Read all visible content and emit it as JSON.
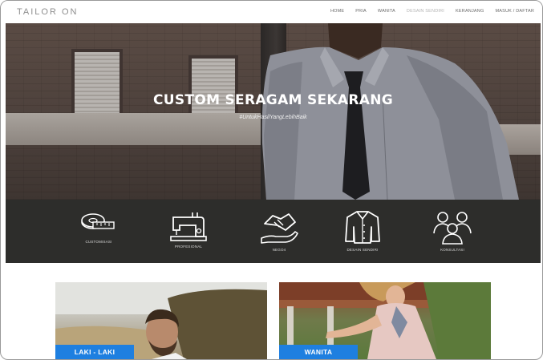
{
  "brand": "TAILOR ON",
  "nav": {
    "items": [
      {
        "label": "HOME",
        "muted": false
      },
      {
        "label": "PRIA",
        "muted": false
      },
      {
        "label": "WANITA",
        "muted": false
      },
      {
        "label": "DESAIN SENDIRI",
        "muted": true
      },
      {
        "label": "KERANJANG",
        "muted": false
      },
      {
        "label": "MASUK / DAFTAR",
        "muted": false
      }
    ]
  },
  "hero": {
    "title": "CUSTOM SERAGAM SEKARANG",
    "subtitle": "#UntukHasilYangLebihBaik"
  },
  "features": [
    {
      "label": "CUSTOMISASI",
      "icon": "measuring-tape-icon"
    },
    {
      "label": "PROFESIONAL",
      "icon": "sewing-machine-icon"
    },
    {
      "label": "NEGO4",
      "icon": "handshake-icon"
    },
    {
      "label": "DESAIN SENDIRI",
      "icon": "shirt-icon"
    },
    {
      "label": "KONSULTASI",
      "icon": "group-people-icon"
    }
  ],
  "categories": [
    {
      "label": "LAKI - LAKI"
    },
    {
      "label": "WANITA"
    }
  ],
  "colors": {
    "accent": "#1e7fe0",
    "feature_bar": "#2d2d2b",
    "nav_text": "#6a6a6a"
  }
}
